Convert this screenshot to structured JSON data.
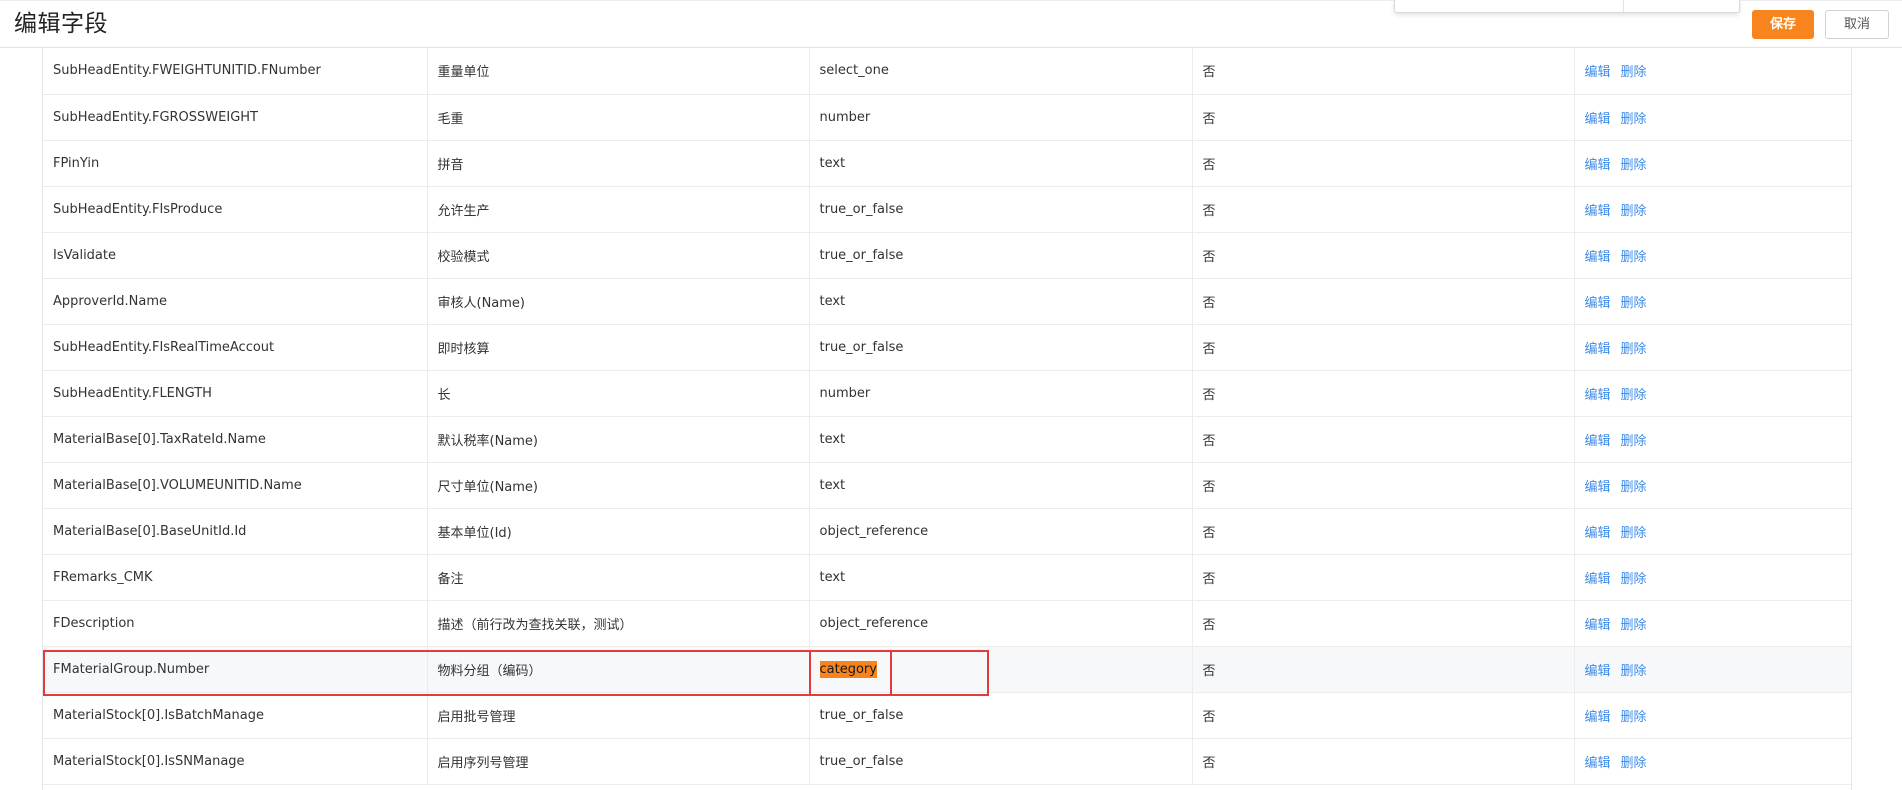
{
  "header": {
    "title": "编辑字段",
    "save_label": "保存",
    "cancel_label": "取消"
  },
  "colors": {
    "accent": "#f7841c",
    "link": "#3e8be6",
    "annotation": "#e23b3b"
  },
  "table": {
    "rows": [
      {
        "field": "SubHeadEntity.FWEIGHTUNITID.FNumber",
        "name": "重量单位",
        "type": "select_one",
        "required": "否",
        "edit": "编辑",
        "delete": "删除"
      },
      {
        "field": "SubHeadEntity.FGROSSWEIGHT",
        "name": "毛重",
        "type": "number",
        "required": "否",
        "edit": "编辑",
        "delete": "删除"
      },
      {
        "field": "FPinYin",
        "name": "拼音",
        "type": "text",
        "required": "否",
        "edit": "编辑",
        "delete": "删除"
      },
      {
        "field": "SubHeadEntity.FIsProduce",
        "name": "允许生产",
        "type": "true_or_false",
        "required": "否",
        "edit": "编辑",
        "delete": "删除"
      },
      {
        "field": "IsValidate",
        "name": "校验模式",
        "type": "true_or_false",
        "required": "否",
        "edit": "编辑",
        "delete": "删除"
      },
      {
        "field": "ApproverId.Name",
        "name": "审核人(Name)",
        "type": "text",
        "required": "否",
        "edit": "编辑",
        "delete": "删除"
      },
      {
        "field": "SubHeadEntity.FIsRealTimeAccout",
        "name": "即时核算",
        "type": "true_or_false",
        "required": "否",
        "edit": "编辑",
        "delete": "删除"
      },
      {
        "field": "SubHeadEntity.FLENGTH",
        "name": "长",
        "type": "number",
        "required": "否",
        "edit": "编辑",
        "delete": "删除"
      },
      {
        "field": "MaterialBase[0].TaxRateId.Name",
        "name": "默认税率(Name)",
        "type": "text",
        "required": "否",
        "edit": "编辑",
        "delete": "删除"
      },
      {
        "field": "MaterialBase[0].VOLUMEUNITID.Name",
        "name": "尺寸单位(Name)",
        "type": "text",
        "required": "否",
        "edit": "编辑",
        "delete": "删除"
      },
      {
        "field": "MaterialBase[0].BaseUnitId.Id",
        "name": "基本单位(Id)",
        "type": "object_reference",
        "required": "否",
        "edit": "编辑",
        "delete": "删除"
      },
      {
        "field": "FRemarks_CMK",
        "name": "备注",
        "type": "text",
        "required": "否",
        "edit": "编辑",
        "delete": "删除"
      },
      {
        "field": "FDescription",
        "name": "描述（前行改为查找关联，测试）",
        "type": "object_reference",
        "required": "否",
        "edit": "编辑",
        "delete": "删除"
      },
      {
        "field": "FMaterialGroup.Number",
        "name": "物料分组（编码）",
        "type": "category",
        "required": "否",
        "edit": "编辑",
        "delete": "删除"
      },
      {
        "field": "MaterialStock[0].IsBatchManage",
        "name": "启用批号管理",
        "type": "true_or_false",
        "required": "否",
        "edit": "编辑",
        "delete": "删除"
      },
      {
        "field": "MaterialStock[0].IsSNManage",
        "name": "启用序列号管理",
        "type": "true_or_false",
        "required": "否",
        "edit": "编辑",
        "delete": "删除"
      }
    ]
  }
}
